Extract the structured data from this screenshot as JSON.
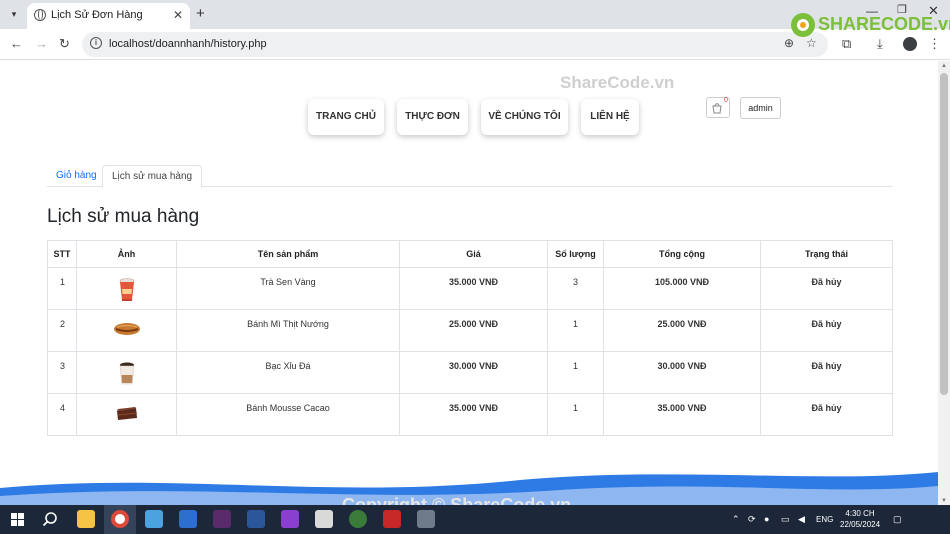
{
  "browser": {
    "tab_title": "Lịch Sử Đơn Hàng",
    "url": "localhost/doannhanh/history.php"
  },
  "nav": {
    "items": [
      "TRANG CHỦ",
      "THỰC ĐƠN",
      "VỀ CHÚNG TÔI",
      "LIÊN HỆ"
    ],
    "cart_count": "0",
    "user": "admin"
  },
  "page_tabs": [
    "Giỏ hàng",
    "Lịch sử mua hàng"
  ],
  "heading": "Lịch sử mua hàng",
  "table": {
    "headers": [
      "STT",
      "Ảnh",
      "Tên sản phẩm",
      "Giá",
      "Số lượng",
      "Tổng cộng",
      "Trạng thái"
    ],
    "rows": [
      {
        "stt": "1",
        "name": "Trà Sen Vàng",
        "price": "35.000 VNĐ",
        "qty": "3",
        "total": "105.000 VNĐ",
        "status": "Đã hủy",
        "image_icon": "tea-cup-icon"
      },
      {
        "stt": "2",
        "name": "Bánh Mì Thịt Nướng",
        "price": "25.000 VNĐ",
        "qty": "1",
        "total": "25.000 VNĐ",
        "status": "Đã hủy",
        "image_icon": "banh-mi-icon"
      },
      {
        "stt": "3",
        "name": "Bạc Xỉu Đá",
        "price": "30.000 VNĐ",
        "qty": "1",
        "total": "30.000 VNĐ",
        "status": "Đã hủy",
        "image_icon": "coffee-cup-icon"
      },
      {
        "stt": "4",
        "name": "Bánh Mousse Cacao",
        "price": "35.000 VNĐ",
        "qty": "1",
        "total": "35.000 VNĐ",
        "status": "Đã hủy",
        "image_icon": "cake-icon"
      }
    ]
  },
  "watermarks": {
    "top": "ShareCode.vn",
    "bottom": "Copyright © ShareCode.vn",
    "logo": "SHARECODE.vn"
  },
  "taskbar": {
    "time": "4:30 CH",
    "date": "22/05/2024",
    "lang": "ENG"
  },
  "colors": {
    "price": "#b5472e",
    "status": "#1f8b3a",
    "link": "#0d6efd",
    "wave": "#2f7be5",
    "taskbar": "#1c2839"
  }
}
